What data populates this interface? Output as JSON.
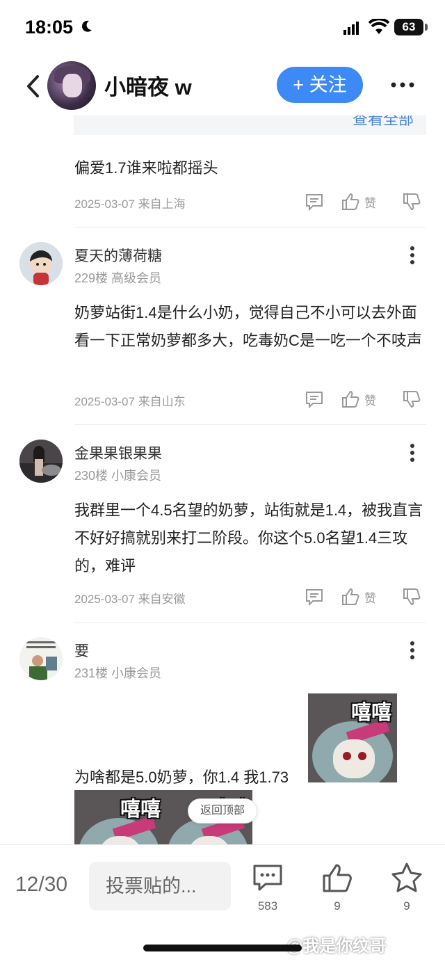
{
  "status_bar": {
    "time": "18:05",
    "battery": "63"
  },
  "header": {
    "title": "小暗夜 w",
    "follow_label": "+ 关注"
  },
  "collapsed_replies": {
    "link": "查看全部"
  },
  "prev_post": {
    "text": "偏爱1.7谁来啦都摇头",
    "meta": "2025-03-07 来自上海",
    "like_label": "赞"
  },
  "comments": [
    {
      "name": "夏天的薄荷糖",
      "floor": "229楼 高级会员",
      "text": "奶萝站街1.4是什么小奶，觉得自己不小可以去外面看一下正常奶萝都多大，吃毒奶C是一吃一个不吱声",
      "meta": "2025-03-07 来自山东",
      "like_label": "赞"
    },
    {
      "name": "金果果银果果",
      "floor": "230楼 小康会员",
      "text": "我群里一个4.5名望的奶萝，站街就是1.4，被我直言不好好搞就别来打二阶段。你这个5.0名望1.4三攻的，难评",
      "meta": "2025-03-07 来自安徽",
      "like_label": "赞"
    },
    {
      "name": "要",
      "floor": "231楼 小康会员",
      "text": "为啥都是5.0奶萝，你1.4 我1.73",
      "sticker_label": "嘻嘻"
    }
  ],
  "back_to_top": "返回顶部",
  "bottom_bar": {
    "pager": "12/30",
    "input_placeholder": "投票贴的...",
    "comment_count": "583",
    "like_count": "9",
    "favorite_count": "9"
  },
  "watermark": "@我是你纹哥",
  "colors": {
    "accent": "#3d8af7",
    "muted": "#9a9a9a"
  },
  "icons": [
    "moon-icon",
    "signal-icon",
    "wifi-icon",
    "back-icon",
    "more-icon",
    "reply-icon",
    "like-icon",
    "dislike-icon",
    "comment-icon",
    "star-icon"
  ]
}
